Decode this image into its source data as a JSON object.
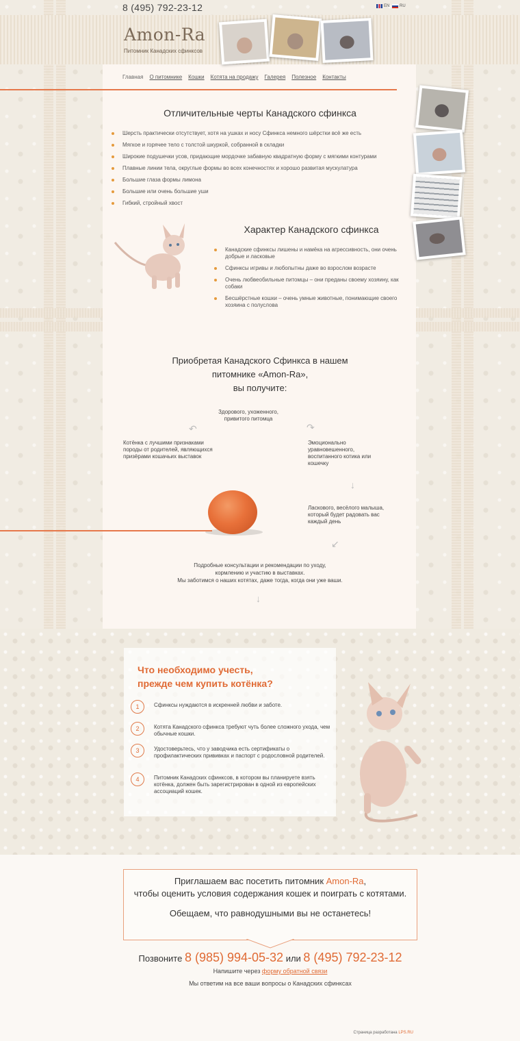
{
  "header": {
    "phone": "8 (495) 792-23-12",
    "lang_en": "EN",
    "lang_ru": "RU",
    "logo": "Amon-Ra",
    "logo_sub": "Питомник Канадских сфинксов"
  },
  "nav": [
    {
      "label": "Главная"
    },
    {
      "label": "О питомнике"
    },
    {
      "label": "Кошки"
    },
    {
      "label": "Котята на продажу"
    },
    {
      "label": "Галерея"
    },
    {
      "label": "Полезное"
    },
    {
      "label": "Контакты"
    }
  ],
  "features": {
    "title": "Отличительные черты Канадского сфинкса",
    "items": [
      "Шерсть практически отсутствует, хотя на ушках и носу Сфинкса немного шёрстки всё же есть",
      "Мягкое и горячее тело с толстой шкуркой, собранной в складки",
      "Широкие подушечки усов, придающие мордочке забавную квадратную форму с мягкими контурами",
      "Плавные линии тела, округлые формы во всех конечностях и хорошо развитая мускулатура",
      "Большие глаза формы лимона",
      "Большие или очень большие уши",
      "Гибкий, стройный хвост"
    ]
  },
  "character": {
    "title": "Характер Канадского сфинкса",
    "items": [
      "Канадские сфинксы лишены и намёка на агрессивность, они очень добрые и ласковые",
      "Сфинксы игривы и любопытны даже во взрослом возрасте",
      "Очень любвеобильные питомцы – они преданы своему хозяину, как собаки",
      "Бесшёрстные кошки – очень умные животные, понимающие своего хозяина с полуслова"
    ]
  },
  "benefits": {
    "title_line1": "Приобретая Канадского Сфинкса в нашем",
    "title_line2": "питомнике «Amon-Ra»,",
    "title_line3": "вы получите:",
    "b1": "Здорового, ухоженного, привитого питомца",
    "b2": "Котёнка с лучшими признаками породы от родителей, являющихся призёрами кошачьих выставок",
    "b3": "Эмоционально уравновешенного, воспитанного котика или кошечку",
    "b4": "Ласкового, весёлого малыша, который будет радовать вас каждый день",
    "b5_line1": "Подробные консультации и рекомендации по уходу,",
    "b5_line2": "кормлению и участию в выставках.",
    "b5_line3": "Мы заботимся о наших котятах, даже тогда, когда они уже ваши."
  },
  "tips": {
    "title_line1": "Что необходимо учесть,",
    "title_line2": "прежде чем купить котёнка?",
    "items": [
      {
        "num": "1",
        "text": "Сфинксы нуждаются в искренней любви и заботе."
      },
      {
        "num": "2",
        "text": "Котята Канадского сфинкса требуют чуть более сложного ухода, чем обычные кошки."
      },
      {
        "num": "3",
        "text": "Удостоверьтесь, что у заводчика есть сертификаты о профилактических прививках и паспорт с родословной родителей."
      },
      {
        "num": "4",
        "text": "Питомник Канадских сфинксов, в котором вы планируете взять котёнка, должен быть зарегистрирован в одной из европейских ассоциаций кошек."
      }
    ]
  },
  "invite": {
    "line1_prefix": "Приглашаем вас посетить питомник ",
    "line1_brand": "Amon-Ra",
    "line1_suffix": ",",
    "line2": "чтобы оценить условия содержания кошек и поиграть с котятами.",
    "line3": "Обещаем, что равнодушными вы не останетесь!"
  },
  "contact": {
    "call_prefix": "Позвоните",
    "phone1": "8 (985) 994-05-32",
    "or": "или",
    "phone2": "8 (495) 792-23-12",
    "write_prefix": "Напишите через",
    "form_link": "форму обратной связи",
    "answer": "Мы ответим на все ваши вопросы о Канадских сфинксах"
  },
  "footer": {
    "dev_prefix": "Страница разработана",
    "dev_link": "LPS.RU"
  },
  "colors": {
    "accent": "#e06a34",
    "bullet": "#e59a3c",
    "panel": "#fcf6f1"
  }
}
